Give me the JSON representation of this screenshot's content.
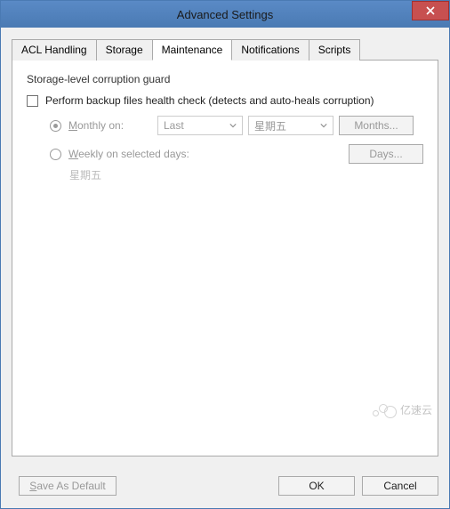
{
  "window": {
    "title": "Advanced Settings"
  },
  "tabs": {
    "t0": "ACL Handling",
    "t1": "Storage",
    "t2": "Maintenance",
    "t3": "Notifications",
    "t4": "Scripts"
  },
  "group": {
    "title": "Storage-level corruption guard",
    "checkbox_label": "Perform backup files health check (detects and auto-heals corruption)",
    "monthly_prefix": "M",
    "monthly_rest": "onthly on:",
    "monthly_select1": "Last",
    "monthly_select2": "星期五",
    "months_btn": "Months...",
    "weekly_prefix": "W",
    "weekly_rest": "eekly on selected days:",
    "weekly_days_text": "星期五",
    "days_btn": "Days..."
  },
  "footer": {
    "save_default_prefix": "S",
    "save_default_rest": "ave As Default",
    "ok": "OK",
    "cancel": "Cancel"
  },
  "watermark": {
    "text": "亿速云"
  }
}
